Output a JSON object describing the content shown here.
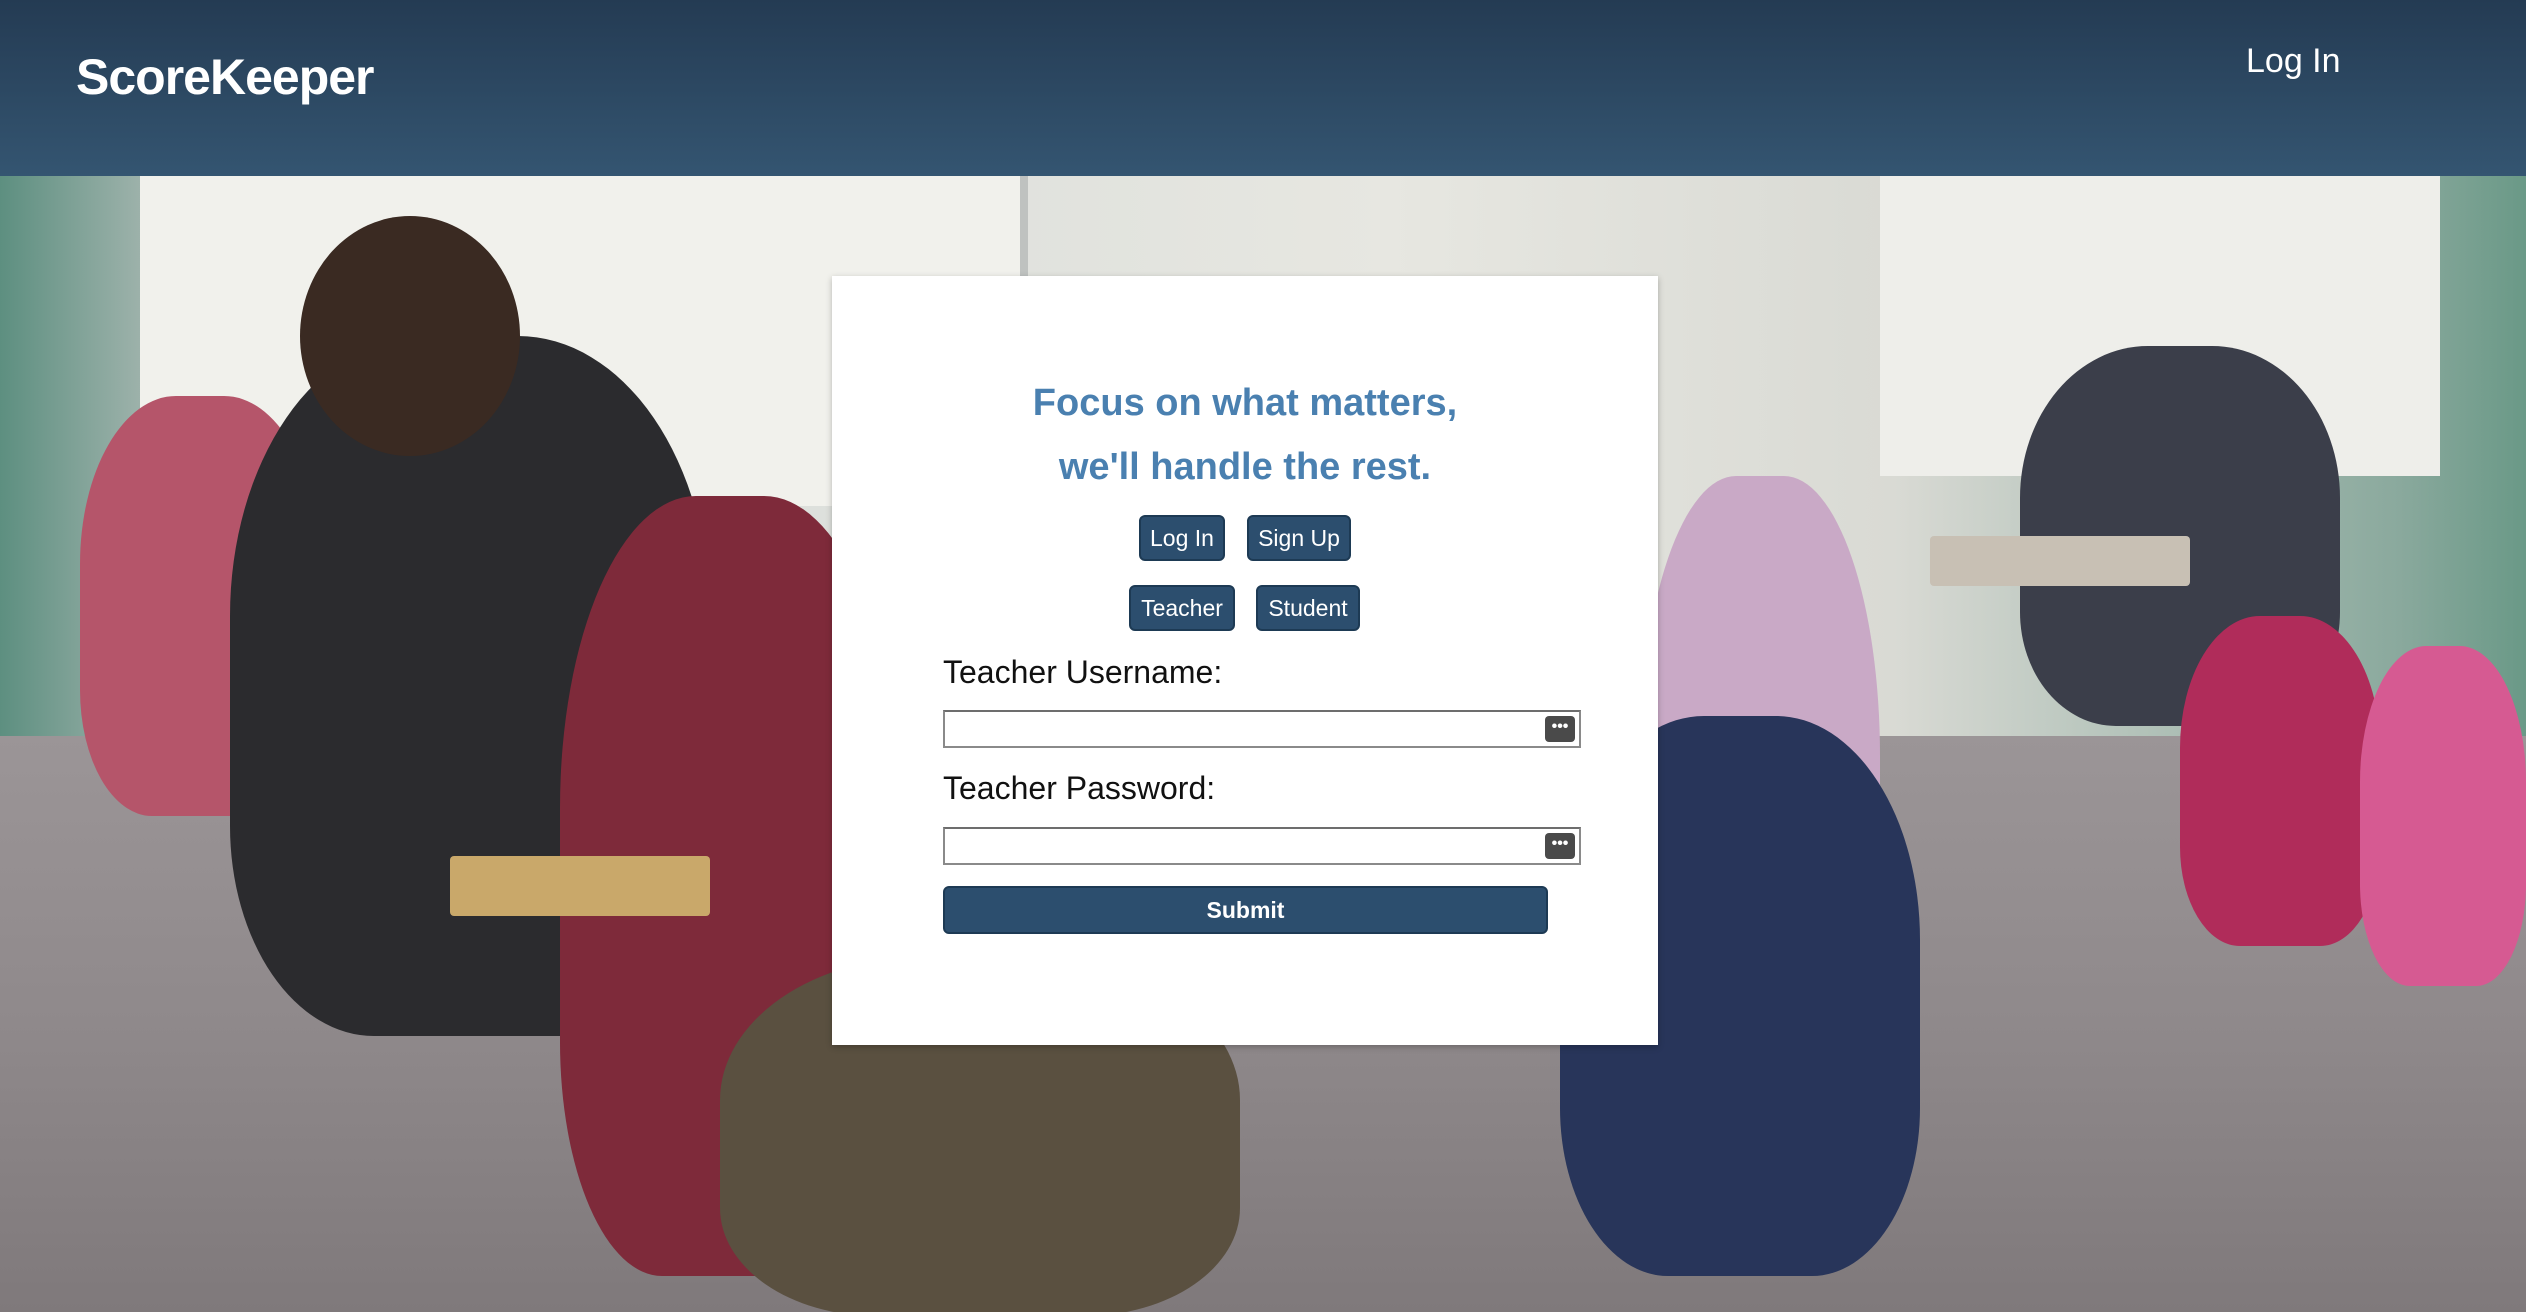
{
  "navbar": {
    "brand": "ScoreKeeper",
    "login_link": "Log In"
  },
  "card": {
    "tagline_line1": "Focus on what matters,",
    "tagline_line2": "we'll handle the rest.",
    "mode_tabs": {
      "login_label": "Log In",
      "signup_label": "Sign Up"
    },
    "role_tabs": {
      "teacher_label": "Teacher",
      "student_label": "Student"
    },
    "username": {
      "label": "Teacher Username:",
      "value": ""
    },
    "password": {
      "label": "Teacher Password:",
      "value": ""
    },
    "submit_label": "Submit"
  },
  "icons": {
    "password_manager_key": "key-icon"
  },
  "colors": {
    "navbar_top": "#243b53",
    "navbar_bottom": "#345571",
    "button_bg": "#2c4e6e",
    "tagline": "#4a80b0",
    "card_bg": "#ffffff"
  }
}
